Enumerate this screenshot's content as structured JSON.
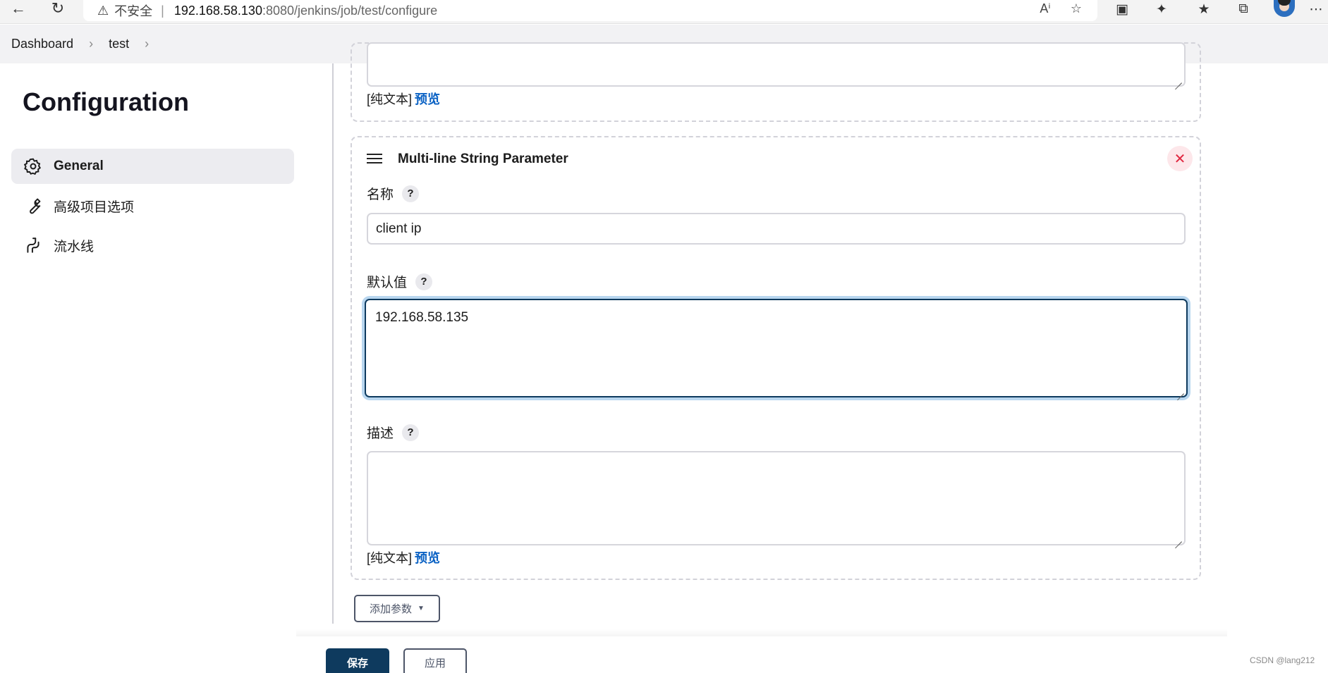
{
  "browser": {
    "security_label": "不安全",
    "url_host": "192.168.58.130",
    "url_path": ":8080/jenkins/job/test/configure"
  },
  "breadcrumb": {
    "items": [
      "Dashboard",
      "test"
    ]
  },
  "sidebar": {
    "title": "Configuration",
    "items": [
      {
        "label": "General",
        "icon": "gear-icon",
        "active": true
      },
      {
        "label": "高级项目选项",
        "icon": "wrench-icon",
        "active": false
      },
      {
        "label": "流水线",
        "icon": "pipeline-icon",
        "active": false
      }
    ]
  },
  "prev_param": {
    "plain_text_label": "[纯文本]",
    "preview_label": "预览"
  },
  "param": {
    "title": "Multi-line String Parameter",
    "name_label": "名称",
    "name_value": "client ip",
    "default_label": "默认值",
    "default_value": "192.168.58.135",
    "description_label": "描述",
    "description_value": "",
    "plain_text_label": "[纯文本]",
    "preview_label": "预览",
    "help_symbol": "?"
  },
  "actions": {
    "add_param_label": "添加参数",
    "save_label": "保存",
    "apply_label": "应用"
  },
  "watermark": "CSDN @lang212",
  "colors": {
    "primary": "#0e3a5e",
    "link": "#0b62c4",
    "danger": "#e0263f"
  }
}
